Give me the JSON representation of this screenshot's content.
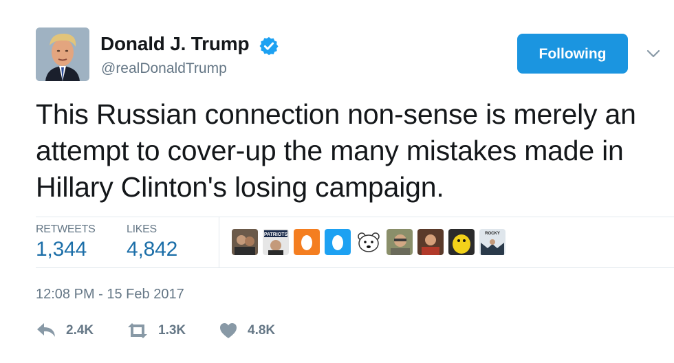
{
  "user": {
    "display_name": "Donald J. Trump",
    "handle": "@realDonaldTrump",
    "verified": true
  },
  "follow_button": {
    "label": "Following",
    "color": "#1b95e0"
  },
  "tweet": {
    "text": "This Russian connection non-sense is merely an attempt to cover-up the many mistakes made in Hillary Clinton's losing campaign."
  },
  "stats": {
    "retweets_label": "RETWEETS",
    "retweets_count": "1,344",
    "likes_label": "LIKES",
    "likes_count": "4,842"
  },
  "likers": [
    {
      "icon": "avatar-photo"
    },
    {
      "icon": "avatar-patriots-logo",
      "text": "PATRIOTS"
    },
    {
      "icon": "default-egg-orange",
      "color": "#f47e20"
    },
    {
      "icon": "default-egg-blue",
      "color": "#1da1f2"
    },
    {
      "icon": "polar-bear-avatar"
    },
    {
      "icon": "avatar-photo"
    },
    {
      "icon": "avatar-photo"
    },
    {
      "icon": "yellow-character-avatar"
    },
    {
      "icon": "avatar-rocky",
      "text": "ROCKY"
    }
  ],
  "timestamp": "12:08 PM - 15 Feb 2017",
  "actions": {
    "reply_count": "2.4K",
    "retweet_count": "1.3K",
    "like_count": "4.8K"
  },
  "colors": {
    "text_primary": "#14171a",
    "text_secondary": "#657786",
    "stat_value": "#1b6ea8",
    "divider": "#e1e8ed"
  }
}
